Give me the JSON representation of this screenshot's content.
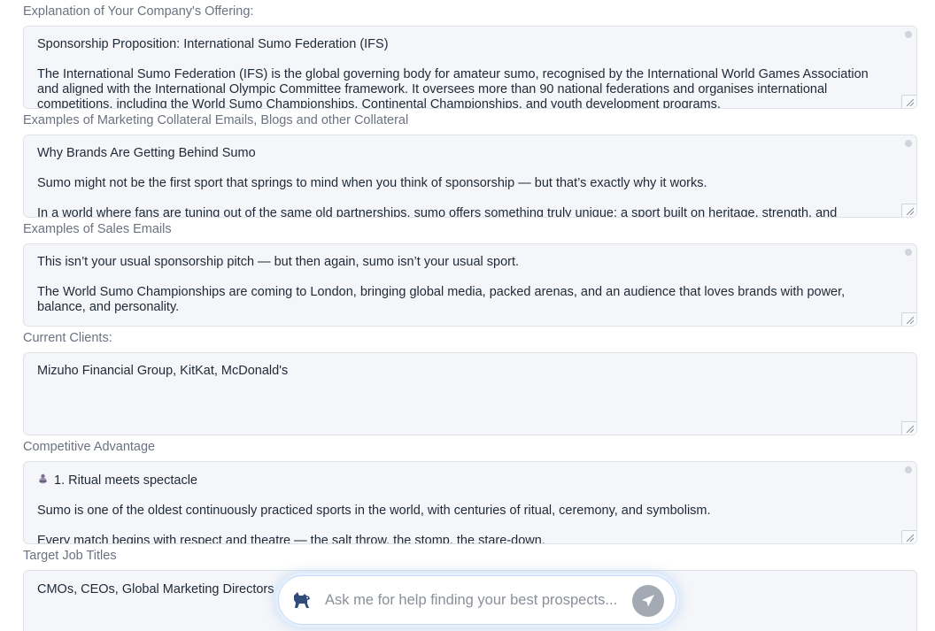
{
  "fields": [
    {
      "label": "Explanation of Your Company's Offering:",
      "paragraphs": [
        "Sponsorship Proposition: International Sumo Federation (IFS)",
        "The International Sumo Federation (IFS) is the global governing body for amateur sumo, recognised by the International World Games Association and aligned with the International Olympic Committee framework. It oversees more than 90 national federations and organises international competitions, including the World Sumo Championships, Continental Championships, and youth development programs."
      ]
    },
    {
      "label": "Examples of Marketing Collateral Emails, Blogs and other Collateral",
      "paragraphs": [
        "Why Brands Are Getting Behind Sumo",
        "Sumo might not be the first sport that springs to mind when you think of sponsorship — but that’s exactly why it works.",
        "In a world where fans are tuning out of the same old partnerships, sumo offers something truly unique: a sport built on heritage, strength, and"
      ]
    },
    {
      "label": "Examples of Sales Emails",
      "paragraphs": [
        "This isn’t your usual sponsorship pitch — but then again, sumo isn’t your usual sport.",
        "The World Sumo Championships are coming to London, bringing global media, packed arenas, and an audience that loves brands with power, balance, and personality."
      ]
    },
    {
      "label": "Current Clients:",
      "paragraphs": [
        "Mizuho Financial Group, KitKat, McDonald's"
      ]
    },
    {
      "label": "Competitive Advantage",
      "heading": "1. Ritual meets spectacle",
      "paragraphs": [
        "Sumo is one of the oldest continuously practiced sports in the world, with centuries of ritual, ceremony, and symbolism.",
        "Every match begins with respect and theatre — the salt throw, the stomp, the stare-down."
      ]
    },
    {
      "label": "Target Job Titles",
      "paragraphs": [
        "CMOs, CEOs, Global Marketing Directors"
      ]
    }
  ],
  "chat": {
    "placeholder": "Ask me for help finding your best prospects...",
    "dog_icon": "dog-icon",
    "send_icon": "send-icon"
  },
  "colors": {
    "field_background": "#f4f6f9",
    "send_button": "#a3aab4",
    "chat_glow": "#c7dcf8"
  }
}
